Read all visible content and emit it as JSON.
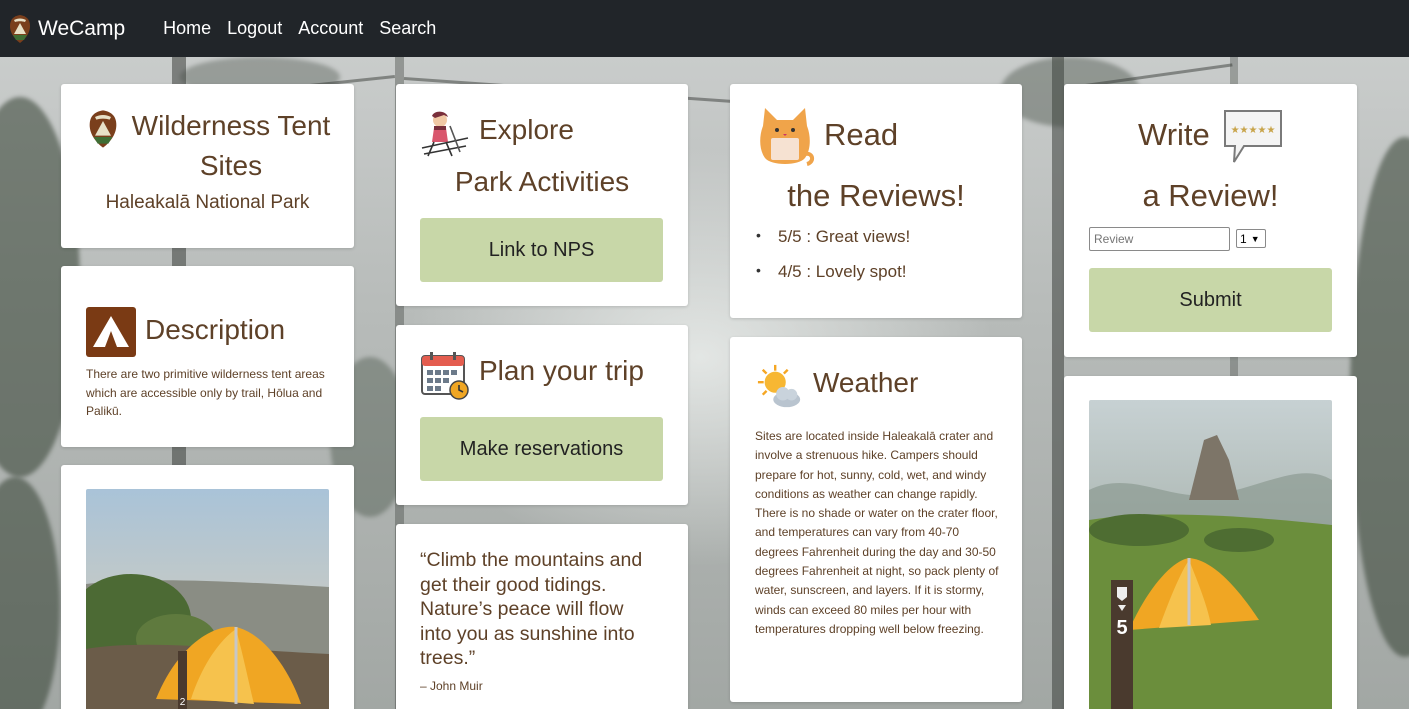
{
  "navbar": {
    "brand": "WeCamp",
    "links": [
      "Home",
      "Logout",
      "Account",
      "Search"
    ]
  },
  "title_card": {
    "title": "Wilderness Tent Sites",
    "subtitle": "Haleakalā National Park"
  },
  "description_card": {
    "heading": "Description",
    "text": "There are two primitive wilderness tent areas which are accessible only by trail, Hōlua and Palikū."
  },
  "explore_card": {
    "heading_line1": "Explore",
    "heading_line2": "Park Activities",
    "button": "Link to NPS"
  },
  "plan_card": {
    "heading": "Plan your trip",
    "button": "Make reservations"
  },
  "quote_card": {
    "quote": "“Climb the mountains and get their good tidings. Nature’s peace will flow into you as sunshine into trees.”",
    "author": "– John Muir"
  },
  "reviews_card": {
    "heading_line1": "Read",
    "heading_line2": "the Reviews!",
    "reviews": [
      "5/5 : Great views!",
      "4/5 : Lovely spot!"
    ]
  },
  "weather_card": {
    "heading": "Weather",
    "text": "Sites are located inside Haleakalā crater and involve a strenuous hike. Campers should prepare for hot, sunny, cold, wet, and windy conditions as weather can change rapidly. There is no shade or water on the crater floor, and temperatures can vary from 40-70 degrees Fahrenheit during the day and 30-50 degrees Fahrenheit at night, so pack plenty of water, sunscreen, and layers. If it is stormy, winds can exceed 80 miles per hour with temperatures dropping well below freezing."
  },
  "write_review_card": {
    "heading_line1": "Write",
    "heading_line2": "a Review!",
    "review_placeholder": "Review",
    "rating_value": "1",
    "submit": "Submit"
  },
  "photos": {
    "left_post_number": "2",
    "right_post_number": "5"
  },
  "icons": {
    "brand": "nps-arrowhead-icon",
    "description": "tent-icon",
    "explore": "hiker-icon",
    "plan": "calendar-icon",
    "reviews": "cat-icon",
    "weather": "partly-sunny-icon",
    "write": "speech-bubble-stars-icon"
  },
  "colors": {
    "navbar": "#212529",
    "button_green": "#c8d7a8",
    "text_brown": "#5e4128"
  }
}
